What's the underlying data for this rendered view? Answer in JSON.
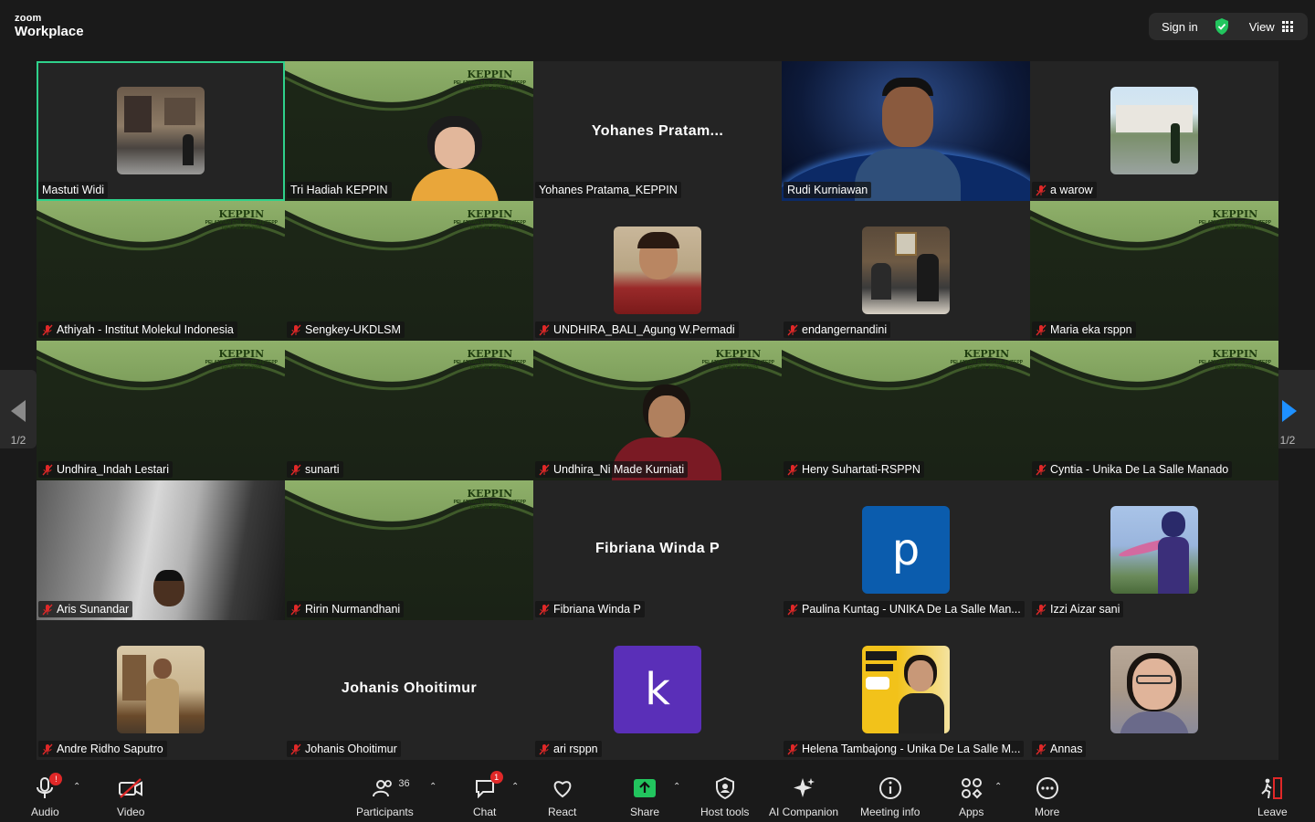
{
  "app": {
    "logo_line1": "zoom",
    "logo_line2": "Workplace"
  },
  "topbar": {
    "sign_in": "Sign in",
    "view": "View"
  },
  "keppin": {
    "title": "KEPPIN",
    "subtitle1": "PELATIHAN EDIL-GCRP-dgITEPP",
    "subtitle2": "Tgl 29-31 Juli 2025"
  },
  "participants_tiles": [
    {
      "name": "Mastuti Widi",
      "muted": false,
      "active": true,
      "kind": "photo"
    },
    {
      "name": "Tri Hadiah KEPPIN",
      "muted": false,
      "kind": "keppin-video"
    },
    {
      "name": "Yohanes Pratama_KEPPIN",
      "muted": false,
      "kind": "text",
      "display": "Yohanes  Pratam..."
    },
    {
      "name": "Rudi Kurniawan",
      "muted": false,
      "kind": "space-video"
    },
    {
      "name": "a warow",
      "muted": true,
      "kind": "photo"
    },
    {
      "name": "Athiyah - Institut Molekul Indonesia",
      "muted": true,
      "kind": "keppin"
    },
    {
      "name": "Sengkey-UKDLSM",
      "muted": true,
      "kind": "keppin"
    },
    {
      "name": "UNDHIRA_BALI_Agung W.Permadi",
      "muted": true,
      "kind": "photo"
    },
    {
      "name": "endangernandini",
      "muted": true,
      "kind": "photo"
    },
    {
      "name": "Maria eka rsppn",
      "muted": true,
      "kind": "keppin"
    },
    {
      "name": "Undhira_Indah Lestari",
      "muted": true,
      "kind": "keppin"
    },
    {
      "name": "sunarti",
      "muted": true,
      "kind": "keppin"
    },
    {
      "name": "Undhira_Ni Made Kurniati",
      "muted": true,
      "kind": "keppin-video"
    },
    {
      "name": "Heny Suhartati-RSPPN",
      "muted": true,
      "kind": "keppin"
    },
    {
      "name": "Cyntia - Unika De La Salle Manado",
      "muted": true,
      "kind": "keppin"
    },
    {
      "name": "Aris Sunandar",
      "muted": true,
      "kind": "room-video"
    },
    {
      "name": "Ririn Nurmandhani",
      "muted": true,
      "kind": "keppin"
    },
    {
      "name": "Fibriana Winda P",
      "muted": true,
      "kind": "text",
      "display": "Fibriana Winda P"
    },
    {
      "name": "Paulina Kuntag - UNIKA De La Salle Man...",
      "muted": true,
      "kind": "letter",
      "letter": "p",
      "color": "#0b5cad"
    },
    {
      "name": "Izzi Aizar sani",
      "muted": true,
      "kind": "photo"
    },
    {
      "name": "Andre Ridho Saputro",
      "muted": true,
      "kind": "photo"
    },
    {
      "name": "Johanis Ohoitimur",
      "muted": true,
      "kind": "text",
      "display": "Johanis Ohoitimur"
    },
    {
      "name": "ari rsppn",
      "muted": true,
      "kind": "letter",
      "letter": "k",
      "color": "#5a2fb8"
    },
    {
      "name": "Helena Tambajong - Unika De La Salle M...",
      "muted": true,
      "kind": "photo"
    },
    {
      "name": "Annas",
      "muted": true,
      "kind": "photo"
    }
  ],
  "pager": {
    "left": "1/2",
    "right": "1/2"
  },
  "toolbar": {
    "audio": "Audio",
    "audio_badge": "!",
    "video": "Video",
    "participants": "Participants",
    "participants_count": "36",
    "chat": "Chat",
    "chat_badge": "1",
    "react": "React",
    "share": "Share",
    "host_tools": "Host tools",
    "ai_companion": "AI Companion",
    "meeting_info": "Meeting info",
    "apps": "Apps",
    "more": "More",
    "leave": "Leave"
  },
  "colors": {
    "active_border": "#2fd18b",
    "share_green": "#22c55e",
    "leave_red": "#e02828",
    "accent_blue": "#1e90ff"
  }
}
